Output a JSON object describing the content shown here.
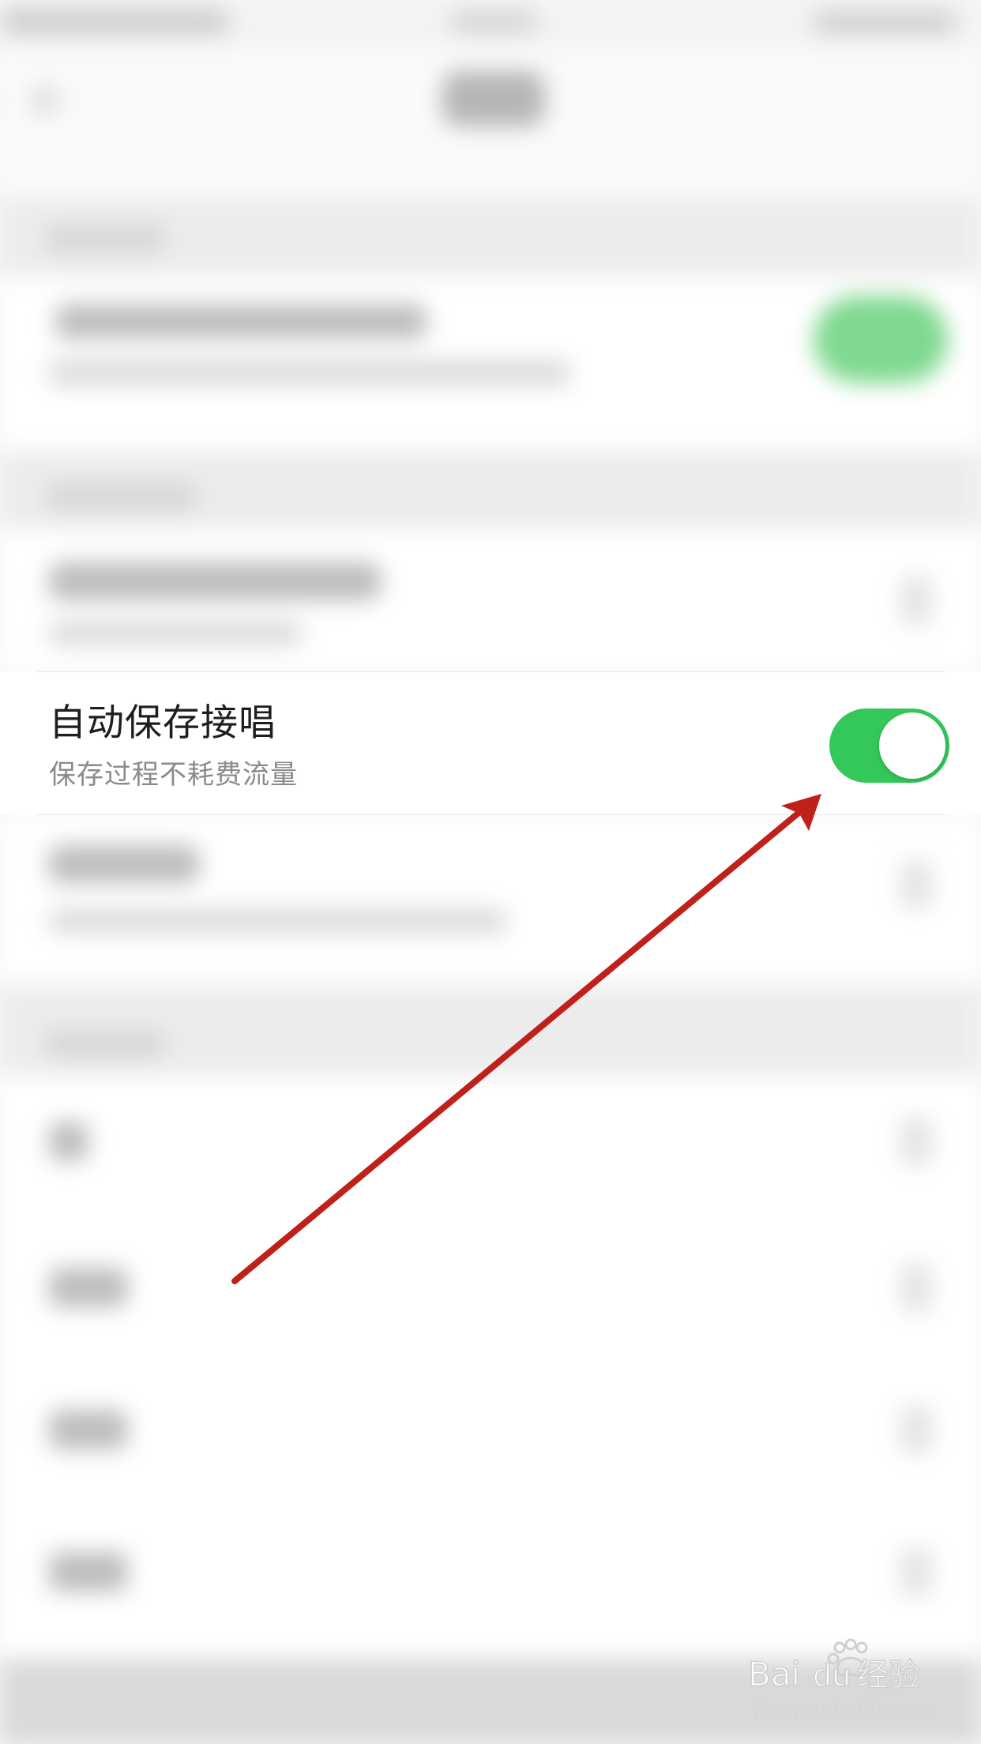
{
  "setting": {
    "title": "自动保存接唱",
    "subtitle": "保存过程不耗费流量",
    "toggle_on": true
  },
  "colors": {
    "toggle_on": "#34c759",
    "arrow": "#c0201a"
  },
  "watermark": {
    "brand": "Baidu经验",
    "url": "jingyan.baidu.com"
  }
}
